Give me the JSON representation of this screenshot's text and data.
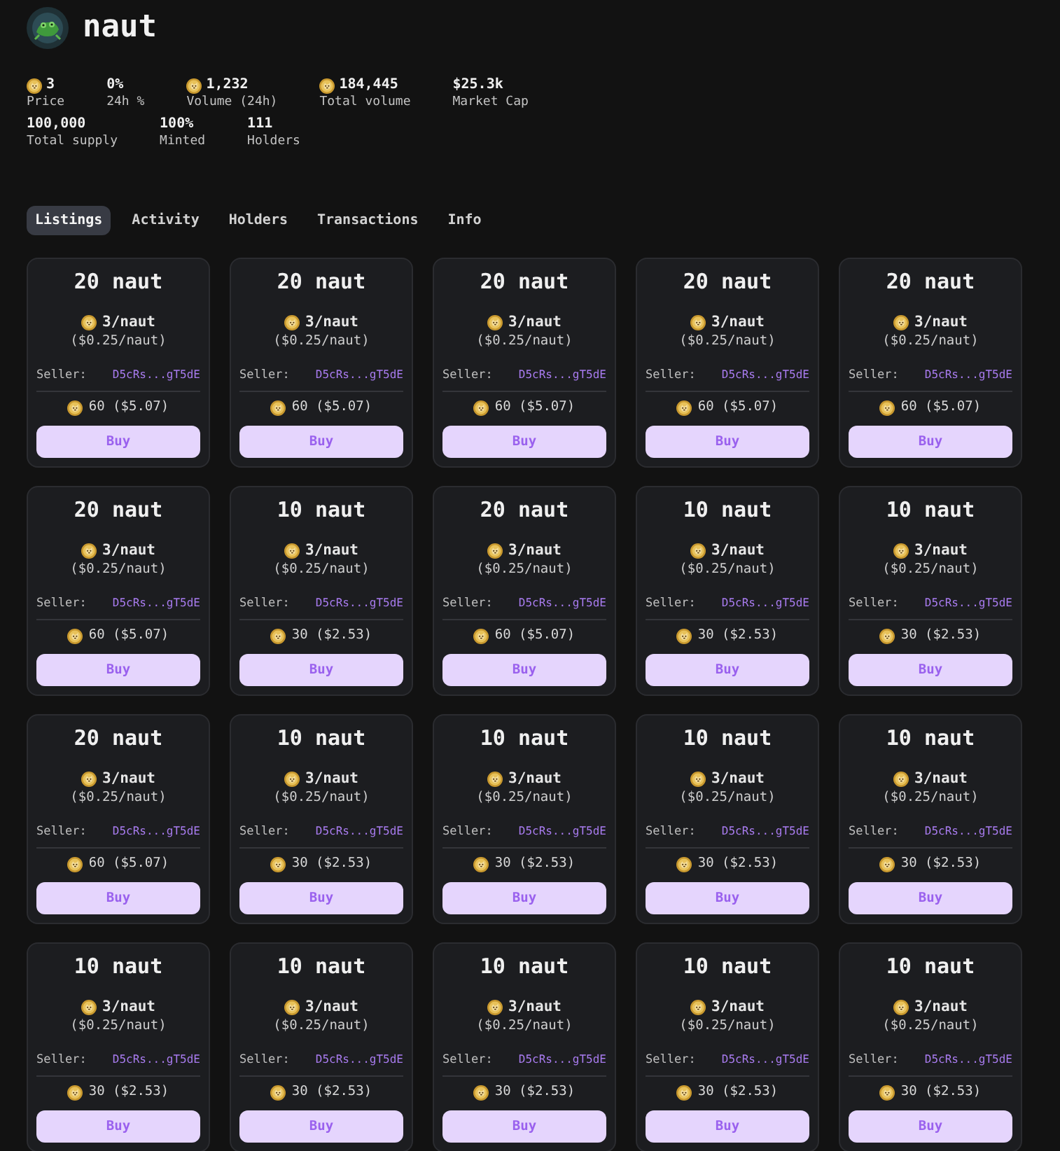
{
  "header": {
    "title": "naut"
  },
  "stats": [
    {
      "value": "3",
      "label": "Price",
      "coin": true
    },
    {
      "value": "0%",
      "label": "24h %",
      "coin": false
    },
    {
      "value": "1,232",
      "label": "Volume (24h)",
      "coin": true
    },
    {
      "value": "184,445",
      "label": "Total volume",
      "coin": true
    },
    {
      "value": "$25.3k",
      "label": "Market Cap",
      "coin": false
    },
    {
      "value": "100,000",
      "label": "Total supply",
      "coin": false
    },
    {
      "value": "100%",
      "label": "Minted",
      "coin": false
    },
    {
      "value": "111",
      "label": "Holders",
      "coin": false
    }
  ],
  "tabs": [
    {
      "label": "Listings",
      "selected": true
    },
    {
      "label": "Activity",
      "selected": false
    },
    {
      "label": "Holders",
      "selected": false
    },
    {
      "label": "Transactions",
      "selected": false
    },
    {
      "label": "Info",
      "selected": false
    }
  ],
  "listings": [
    {
      "amount": "20 naut",
      "price": "3/naut",
      "price_usd": "($0.25/naut)",
      "seller_label": "Seller:",
      "seller": "D5cRs...gT5dE",
      "total": "60 ($5.07)",
      "button": "Buy"
    },
    {
      "amount": "20 naut",
      "price": "3/naut",
      "price_usd": "($0.25/naut)",
      "seller_label": "Seller:",
      "seller": "D5cRs...gT5dE",
      "total": "60 ($5.07)",
      "button": "Buy"
    },
    {
      "amount": "20 naut",
      "price": "3/naut",
      "price_usd": "($0.25/naut)",
      "seller_label": "Seller:",
      "seller": "D5cRs...gT5dE",
      "total": "60 ($5.07)",
      "button": "Buy"
    },
    {
      "amount": "20 naut",
      "price": "3/naut",
      "price_usd": "($0.25/naut)",
      "seller_label": "Seller:",
      "seller": "D5cRs...gT5dE",
      "total": "60 ($5.07)",
      "button": "Buy"
    },
    {
      "amount": "20 naut",
      "price": "3/naut",
      "price_usd": "($0.25/naut)",
      "seller_label": "Seller:",
      "seller": "D5cRs...gT5dE",
      "total": "60 ($5.07)",
      "button": "Buy"
    },
    {
      "amount": "20 naut",
      "price": "3/naut",
      "price_usd": "($0.25/naut)",
      "seller_label": "Seller:",
      "seller": "D5cRs...gT5dE",
      "total": "60 ($5.07)",
      "button": "Buy"
    },
    {
      "amount": "10 naut",
      "price": "3/naut",
      "price_usd": "($0.25/naut)",
      "seller_label": "Seller:",
      "seller": "D5cRs...gT5dE",
      "total": "30 ($2.53)",
      "button": "Buy"
    },
    {
      "amount": "20 naut",
      "price": "3/naut",
      "price_usd": "($0.25/naut)",
      "seller_label": "Seller:",
      "seller": "D5cRs...gT5dE",
      "total": "60 ($5.07)",
      "button": "Buy"
    },
    {
      "amount": "10 naut",
      "price": "3/naut",
      "price_usd": "($0.25/naut)",
      "seller_label": "Seller:",
      "seller": "D5cRs...gT5dE",
      "total": "30 ($2.53)",
      "button": "Buy"
    },
    {
      "amount": "10 naut",
      "price": "3/naut",
      "price_usd": "($0.25/naut)",
      "seller_label": "Seller:",
      "seller": "D5cRs...gT5dE",
      "total": "30 ($2.53)",
      "button": "Buy"
    },
    {
      "amount": "20 naut",
      "price": "3/naut",
      "price_usd": "($0.25/naut)",
      "seller_label": "Seller:",
      "seller": "D5cRs...gT5dE",
      "total": "60 ($5.07)",
      "button": "Buy"
    },
    {
      "amount": "10 naut",
      "price": "3/naut",
      "price_usd": "($0.25/naut)",
      "seller_label": "Seller:",
      "seller": "D5cRs...gT5dE",
      "total": "30 ($2.53)",
      "button": "Buy"
    },
    {
      "amount": "10 naut",
      "price": "3/naut",
      "price_usd": "($0.25/naut)",
      "seller_label": "Seller:",
      "seller": "D5cRs...gT5dE",
      "total": "30 ($2.53)",
      "button": "Buy"
    },
    {
      "amount": "10 naut",
      "price": "3/naut",
      "price_usd": "($0.25/naut)",
      "seller_label": "Seller:",
      "seller": "D5cRs...gT5dE",
      "total": "30 ($2.53)",
      "button": "Buy"
    },
    {
      "amount": "10 naut",
      "price": "3/naut",
      "price_usd": "($0.25/naut)",
      "seller_label": "Seller:",
      "seller": "D5cRs...gT5dE",
      "total": "30 ($2.53)",
      "button": "Buy"
    },
    {
      "amount": "10 naut",
      "price": "3/naut",
      "price_usd": "($0.25/naut)",
      "seller_label": "Seller:",
      "seller": "D5cRs...gT5dE",
      "total": "30 ($2.53)",
      "button": "Buy"
    },
    {
      "amount": "10 naut",
      "price": "3/naut",
      "price_usd": "($0.25/naut)",
      "seller_label": "Seller:",
      "seller": "D5cRs...gT5dE",
      "total": "30 ($2.53)",
      "button": "Buy"
    },
    {
      "amount": "10 naut",
      "price": "3/naut",
      "price_usd": "($0.25/naut)",
      "seller_label": "Seller:",
      "seller": "D5cRs...gT5dE",
      "total": "30 ($2.53)",
      "button": "Buy"
    },
    {
      "amount": "10 naut",
      "price": "3/naut",
      "price_usd": "($0.25/naut)",
      "seller_label": "Seller:",
      "seller": "D5cRs...gT5dE",
      "total": "30 ($2.53)",
      "button": "Buy"
    },
    {
      "amount": "10 naut",
      "price": "3/naut",
      "price_usd": "($0.25/naut)",
      "seller_label": "Seller:",
      "seller": "D5cRs...gT5dE",
      "total": "30 ($2.53)",
      "button": "Buy"
    }
  ]
}
